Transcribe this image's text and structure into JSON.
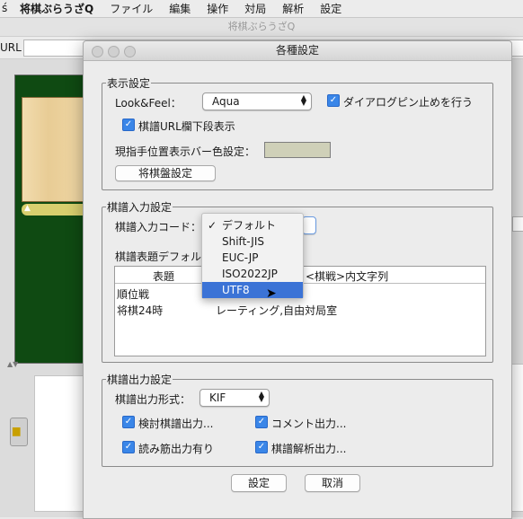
{
  "menubar": {
    "app_name": "将棋ぶらうざQ",
    "items": [
      "ファイル",
      "編集",
      "操作",
      "対局",
      "解析",
      "設定"
    ]
  },
  "main_window": {
    "title": "将棋ぶらうざQ",
    "url_label": "URL"
  },
  "dialog": {
    "title": "各種設定",
    "display_settings": {
      "legend": "表示設定",
      "look_feel_label": "Look&Feel：",
      "look_feel_value": "Aqua",
      "dialog_pin_label": "ダイアログピン止めを行う",
      "dialog_pin_checked": true,
      "kifu_url_lower_label": "棋譜URL欄下段表示",
      "kifu_url_lower_checked": true,
      "current_pos_bar_color_label": "現指手位置表示バー色設定：",
      "current_pos_bar_color": "#cfd0b8",
      "board_settings_button": "将棋盤設定"
    },
    "kifu_input_settings": {
      "legend": "棋譜入力設定",
      "input_code_label": "棋譜入力コード：",
      "title_default_label": "棋譜表題デフォル",
      "table": {
        "headers": [
          "表題",
          "<棋戦>内文字列"
        ],
        "rows": [
          [
            "順位戦",
            ""
          ],
          [
            "将棋24時",
            "レーティング,自由対局室"
          ]
        ]
      },
      "encoding_menu": {
        "options": [
          "デフォルト",
          "Shift-JIS",
          "EUC-JP",
          "ISO2022JP",
          "UTF8"
        ],
        "checked": "デフォルト",
        "highlighted": "UTF8",
        "check_mark": "✓"
      }
    },
    "kifu_output_settings": {
      "legend": "棋譜出力設定",
      "output_format_label": "棋譜出力形式：",
      "output_format_value": "KIF",
      "options": [
        {
          "label": "検討棋譜出力...",
          "checked": true
        },
        {
          "label": "コメント出力...",
          "checked": true
        },
        {
          "label": "読み筋出力有り",
          "checked": true
        },
        {
          "label": "棋譜解析出力...",
          "checked": true
        }
      ]
    },
    "ok_button": "設定",
    "cancel_button": "取消"
  },
  "colors": {
    "accent": "#3b73d6",
    "board_panel": "#0f4a12"
  }
}
